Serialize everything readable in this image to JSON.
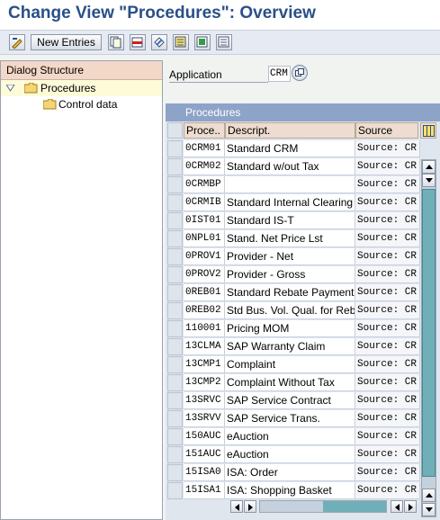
{
  "title": "Change View \"Procedures\": Overview",
  "toolbar": {
    "new_entries_label": "New Entries",
    "icons": [
      "display-change-icon",
      "copy-icon",
      "delete-icon",
      "undo-icon",
      "select-all-icon",
      "select-block-icon",
      "deselect-all-icon"
    ]
  },
  "dialog_structure": {
    "header": "Dialog Structure",
    "items": [
      {
        "label": "Procedures",
        "selected": true,
        "expanded": true
      },
      {
        "label": "Control data",
        "selected": false
      }
    ]
  },
  "application": {
    "label": "Application",
    "value": "CRM"
  },
  "table": {
    "caption": "Procedures",
    "columns": [
      "Proce..",
      "Descript.",
      "Source"
    ],
    "rows": [
      {
        "code": "0CRM01",
        "desc": "Standard CRM",
        "source": "Source: CR"
      },
      {
        "code": "0CRM02",
        "desc": "Standard w/out Tax",
        "source": "Source: CR"
      },
      {
        "code": "0CRMBP",
        "desc": "",
        "source": "Source: CR"
      },
      {
        "code": "0CRMIB",
        "desc": "Standard Internal Clearing",
        "source": "Source: CR"
      },
      {
        "code": "0IST01",
        "desc": "Standard IS-T",
        "source": "Source: CR"
      },
      {
        "code": "0NPL01",
        "desc": "Stand. Net Price Lst",
        "source": "Source: CR"
      },
      {
        "code": "0PROV1",
        "desc": "Provider - Net",
        "source": "Source: CR"
      },
      {
        "code": "0PROV2",
        "desc": "Provider - Gross",
        "source": "Source: CR"
      },
      {
        "code": "0REB01",
        "desc": "Standard Rebate Payment",
        "source": "Source: CR"
      },
      {
        "code": "0REB02",
        "desc": "Std Bus. Vol. Qual. for Reb",
        "source": "Source: CR"
      },
      {
        "code": "110001",
        "desc": "Pricing MOM",
        "source": "Source: CR"
      },
      {
        "code": "13CLMA",
        "desc": "SAP Warranty Claim",
        "source": "Source: CR"
      },
      {
        "code": "13CMP1",
        "desc": "Complaint",
        "source": "Source: CR"
      },
      {
        "code": "13CMP2",
        "desc": "Complaint Without Tax",
        "source": "Source: CR"
      },
      {
        "code": "13SRVC",
        "desc": "SAP Service Contract",
        "source": "Source: CR"
      },
      {
        "code": "13SRVV",
        "desc": "SAP Service Trans.",
        "source": "Source: CR"
      },
      {
        "code": "150AUC",
        "desc": "eAuction",
        "source": "Source: CR"
      },
      {
        "code": "151AUC",
        "desc": "eAuction",
        "source": "Source: CR"
      },
      {
        "code": "15ISA0",
        "desc": "ISA: Order",
        "source": "Source: CR"
      },
      {
        "code": "15ISA1",
        "desc": "ISA: Shopping Basket",
        "source": "Source: CR"
      }
    ]
  },
  "colors": {
    "title": "#2b4f88",
    "caption_bar": "#8ea3c8",
    "header_cell": "#eddccf",
    "scroll_thumb": "#6fb0b8"
  }
}
